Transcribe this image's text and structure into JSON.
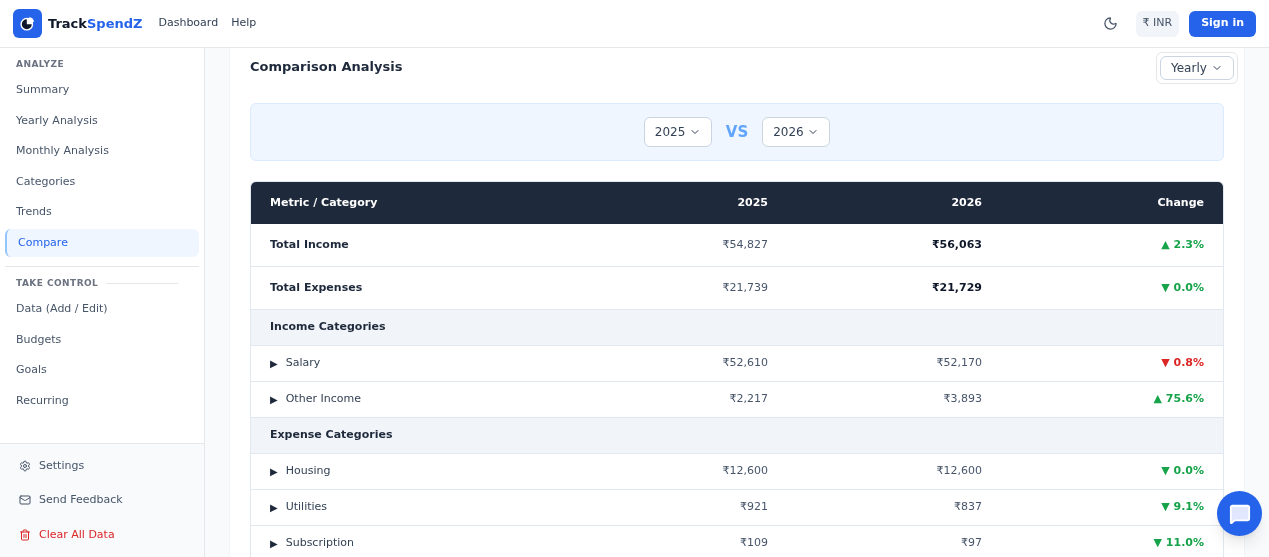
{
  "brand": {
    "name_start": "Track",
    "name_end": "SpendZ"
  },
  "nav": [
    "Dashboard",
    "Help"
  ],
  "currency": "₹ INR",
  "sign_in": "Sign in",
  "sidebar": {
    "sections": [
      {
        "title": "ANALYZE",
        "items": [
          {
            "label": "Summary",
            "selected": false
          },
          {
            "label": "Yearly Analysis",
            "selected": false
          },
          {
            "label": "Monthly Analysis",
            "selected": false
          },
          {
            "label": "Categories",
            "selected": false
          },
          {
            "label": "Trends",
            "selected": false
          },
          {
            "label": "Compare",
            "selected": true
          }
        ]
      },
      {
        "title": "TAKE CONTROL",
        "items": [
          {
            "label": "Data (Add / Edit)",
            "selected": false
          },
          {
            "label": "Budgets",
            "selected": false
          },
          {
            "label": "Goals",
            "selected": false
          },
          {
            "label": "Recurring",
            "selected": false
          }
        ]
      }
    ],
    "footer": [
      {
        "kind": "settings",
        "label": "Settings"
      },
      {
        "kind": "feedback",
        "label": "Send Feedback"
      },
      {
        "kind": "danger",
        "label": "Clear All Data"
      }
    ]
  },
  "page": {
    "title": "Comparison Analysis",
    "period": "Yearly",
    "year_a": "2025",
    "vs": "VS",
    "year_b": "2026"
  },
  "table": {
    "columns": [
      "Metric / Category",
      "2025",
      "2026",
      "Change"
    ],
    "rows": [
      {
        "kind": "total",
        "label": "Total Income",
        "a": "₹54,827",
        "b": "₹56,063",
        "change": "▲ 2.3%",
        "good": true
      },
      {
        "kind": "total",
        "label": "Total Expenses",
        "a": "₹21,739",
        "b": "₹21,729",
        "change": "▼ 0.0%",
        "good": true
      },
      {
        "kind": "section",
        "label": "Income Categories"
      },
      {
        "kind": "category",
        "toggle": "▶",
        "label": "Salary",
        "a": "₹52,610",
        "b": "₹52,170",
        "change": "▼ 0.8%",
        "good": false
      },
      {
        "kind": "category",
        "toggle": "▶",
        "label": "Other Income",
        "a": "₹2,217",
        "b": "₹3,893",
        "change": "▲ 75.6%",
        "good": true
      },
      {
        "kind": "section",
        "label": "Expense Categories"
      },
      {
        "kind": "category",
        "toggle": "▶",
        "label": "Housing",
        "a": "₹12,600",
        "b": "₹12,600",
        "change": "▼ 0.0%",
        "good": true
      },
      {
        "kind": "category",
        "toggle": "▶",
        "label": "Utilities",
        "a": "₹921",
        "b": "₹837",
        "change": "▼ 9.1%",
        "good": true
      },
      {
        "kind": "category",
        "toggle": "▶",
        "label": "Subscription",
        "a": "₹109",
        "b": "₹97",
        "change": "▼ 11.0%",
        "good": true
      }
    ]
  }
}
